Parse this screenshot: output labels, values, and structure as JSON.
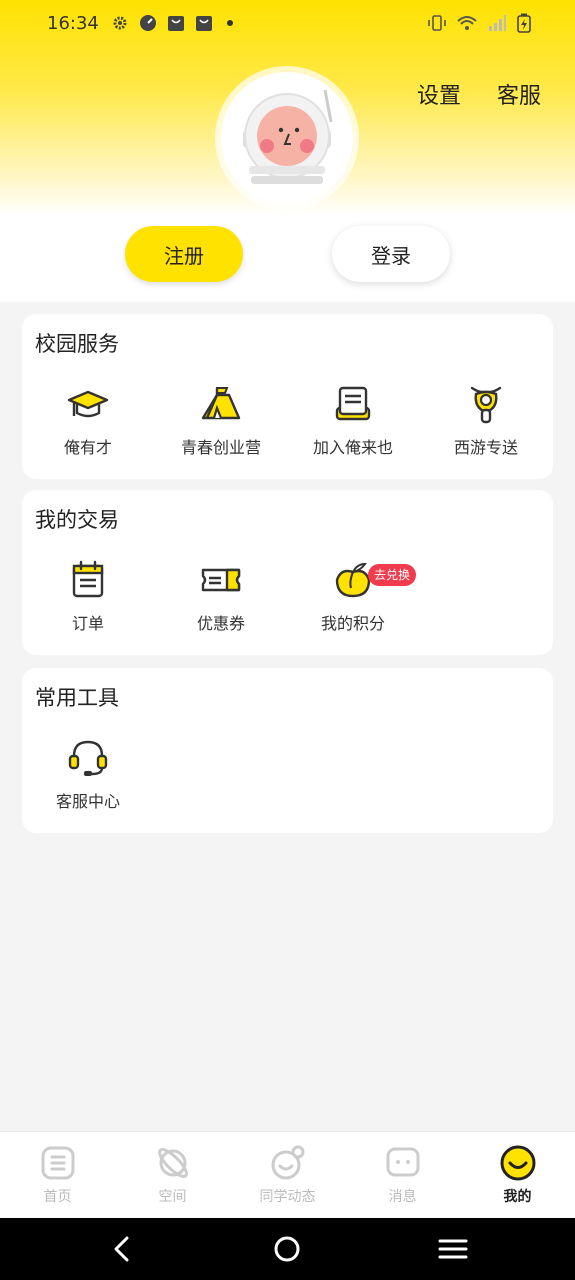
{
  "status_bar": {
    "time": "16:34"
  },
  "header": {
    "settings_label": "设置",
    "support_label": "客服",
    "register_label": "注册",
    "login_label": "登录"
  },
  "campus_services": {
    "title": "校园服务",
    "items": [
      {
        "label": "俺有才",
        "icon": "graduation-cap-icon"
      },
      {
        "label": "青春创业营",
        "icon": "tent-icon"
      },
      {
        "label": "加入俺来也",
        "icon": "register-box-icon"
      },
      {
        "label": "西游专送",
        "icon": "scooter-icon"
      }
    ]
  },
  "my_trade": {
    "title": "我的交易",
    "items": [
      {
        "label": "订单",
        "icon": "calendar-icon"
      },
      {
        "label": "优惠券",
        "icon": "ticket-icon"
      },
      {
        "label": "我的积分",
        "icon": "peach-icon",
        "badge": "去兑换"
      }
    ]
  },
  "common_tools": {
    "title": "常用工具",
    "items": [
      {
        "label": "客服中心",
        "icon": "headset-icon"
      }
    ]
  },
  "tab_bar": {
    "tabs": [
      {
        "label": "首页",
        "icon": "home-icon"
      },
      {
        "label": "空间",
        "icon": "planet-icon"
      },
      {
        "label": "同学动态",
        "icon": "moments-icon"
      },
      {
        "label": "消息",
        "icon": "message-icon"
      },
      {
        "label": "我的",
        "icon": "me-smile-icon",
        "active": true
      }
    ]
  },
  "colors": {
    "accent": "#FFE200",
    "badge": "#F03C4D",
    "icon_dark": "#333333",
    "tab_inactive": "#BBBBBB"
  }
}
